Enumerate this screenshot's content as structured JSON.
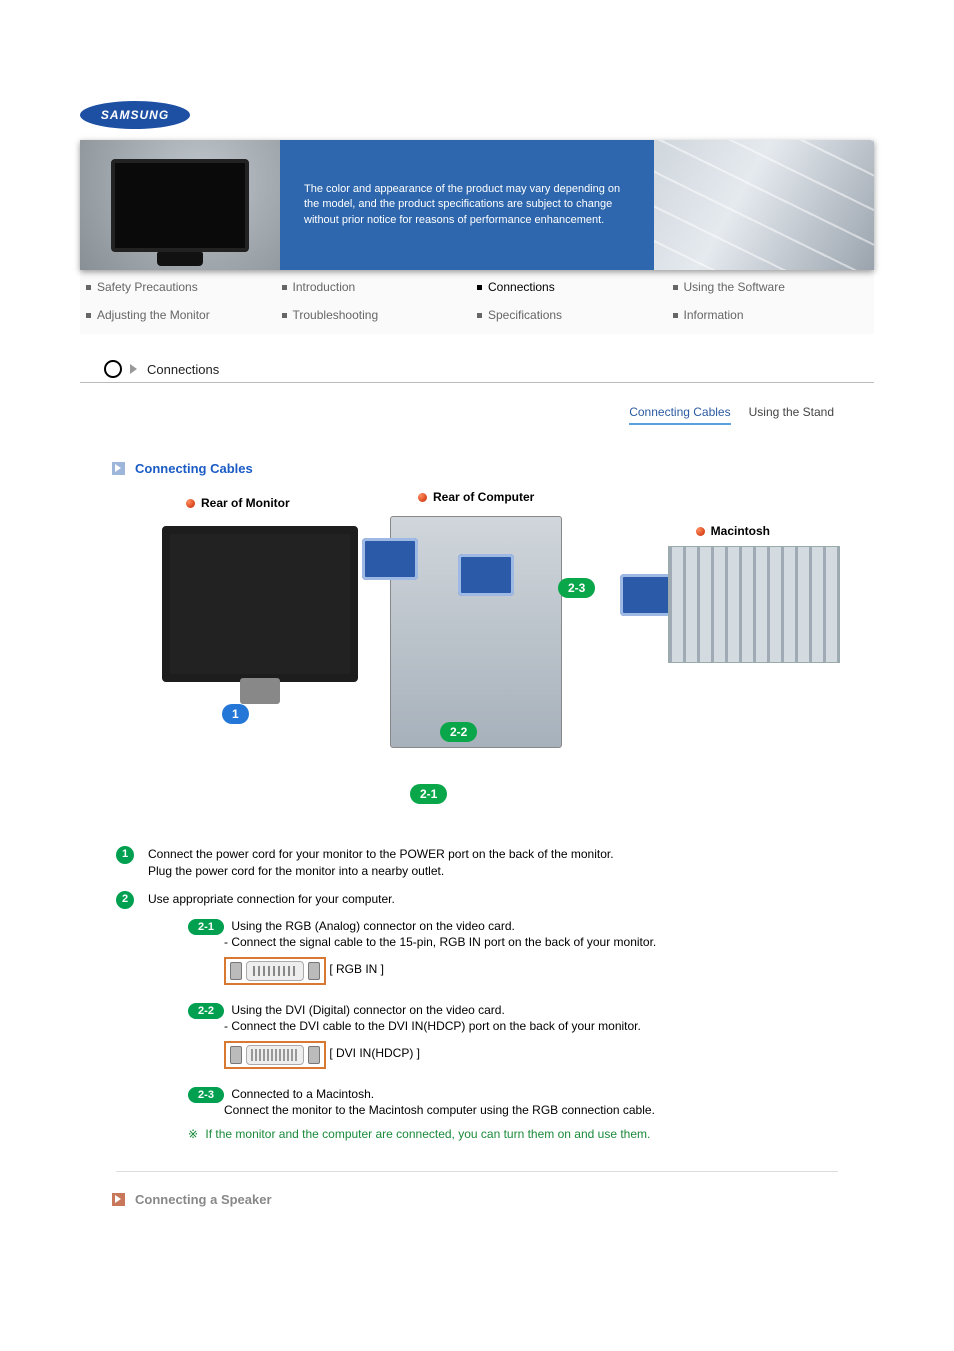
{
  "brand": "SAMSUNG",
  "hero_notice": "The color and appearance of the product may vary depending on the model, and the product specifications are subject to change without prior notice for reasons of performance enhancement.",
  "nav": {
    "items": [
      {
        "label": "Safety Precautions",
        "active": false
      },
      {
        "label": "Introduction",
        "active": false
      },
      {
        "label": "Connections",
        "active": true
      },
      {
        "label": "Using the Software",
        "active": false
      },
      {
        "label": "Adjusting the Monitor",
        "active": false
      },
      {
        "label": "Troubleshooting",
        "active": false
      },
      {
        "label": "Specifications",
        "active": false
      },
      {
        "label": "Information",
        "active": false
      }
    ]
  },
  "breadcrumb": "Connections",
  "subtabs": [
    {
      "label": "Connecting Cables",
      "active": true
    },
    {
      "label": "Using the Stand",
      "active": false
    }
  ],
  "section1_title": "Connecting Cables",
  "diagram": {
    "labels": {
      "rear_monitor": "Rear of Monitor",
      "rear_computer": "Rear of Computer",
      "macintosh": "Macintosh"
    },
    "pills": {
      "p1": "1",
      "p21": "2-1",
      "p22": "2-2",
      "p23": "2-3"
    }
  },
  "steps": {
    "s1_num": "1",
    "s1_a": "Connect the power cord for your monitor to the POWER port on the back of the monitor.",
    "s1_b": "Plug the power cord for the monitor into a nearby outlet.",
    "s2_num": "2",
    "s2": "Use appropriate connection for your computer.",
    "s21_badge": "2-1",
    "s21_a": "Using the RGB (Analog) connector on the video card.",
    "s21_b": "- Connect the signal cable to the 15-pin, RGB IN port on the back of your monitor.",
    "s21_port": "[ RGB IN ]",
    "s22_badge": "2-2",
    "s22_a": "Using the DVI (Digital) connector on the video card.",
    "s22_b": "- Connect the DVI cable to the DVI IN(HDCP) port on the back of your monitor.",
    "s22_port": "[ DVI IN(HDCP) ]",
    "s23_badge": "2-3",
    "s23_a": "Connected to a Macintosh.",
    "s23_b": "Connect the monitor to the Macintosh computer using the RGB connection cable.",
    "note": "If the monitor and the computer are connected, you can turn them on and use them."
  },
  "section2_title": "Connecting a Speaker"
}
